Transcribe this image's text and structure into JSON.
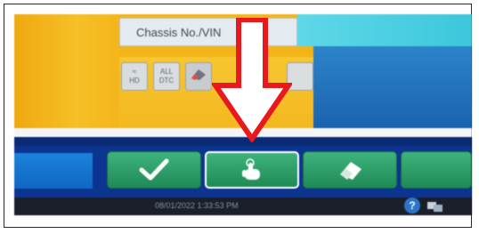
{
  "chassis_field": {
    "label": "Chassis No./VIN"
  },
  "toolbar_small": {
    "items": [
      {
        "label": "≈\nHD"
      },
      {
        "label": "ALL\nDTC"
      },
      {
        "label": ""
      },
      {
        "label": ""
      }
    ]
  },
  "bottom_toolbar": {
    "buttons": [
      {
        "name": "confirm",
        "icon": "checkmark-icon",
        "selected": false
      },
      {
        "name": "touch",
        "icon": "hand-tap-icon",
        "selected": true
      },
      {
        "name": "erase",
        "icon": "eraser-icon",
        "selected": false
      }
    ]
  },
  "status_bar": {
    "datetime": "08/01/2022 1:33:53 PM"
  },
  "annotation": {
    "icon": "red-down-arrow-icon"
  },
  "colors": {
    "yellow": "#f2b417",
    "cyan": "#4fd0e2",
    "navy": "#0c3591",
    "button_green": "#2a9a63",
    "arrow_red": "#e8191c"
  }
}
